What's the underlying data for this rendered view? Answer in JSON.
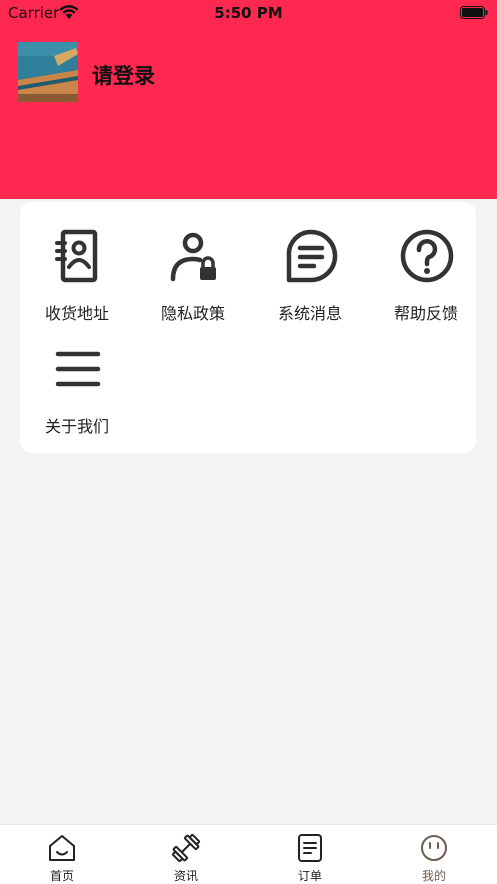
{
  "status_bar": {
    "carrier": "Carrier",
    "time": "5:50 PM"
  },
  "header": {
    "login_label": "请登录"
  },
  "menu": {
    "items": [
      {
        "label": "收货地址",
        "icon": "address-book-icon"
      },
      {
        "label": "隐私政策",
        "icon": "user-lock-icon"
      },
      {
        "label": "系统消息",
        "icon": "message-icon"
      },
      {
        "label": "帮助反馈",
        "icon": "help-icon"
      },
      {
        "label": "关于我们",
        "icon": "menu-lines-icon"
      }
    ]
  },
  "tabbar": {
    "tabs": [
      {
        "label": "首页",
        "icon": "home-icon"
      },
      {
        "label": "资讯",
        "icon": "dumbbell-icon"
      },
      {
        "label": "订单",
        "icon": "order-icon"
      },
      {
        "label": "我的",
        "icon": "face-icon",
        "active": true
      }
    ]
  },
  "colors": {
    "accent": "#fe2851",
    "background": "#f3f3f5",
    "active_tab": "#6b5d4f"
  }
}
